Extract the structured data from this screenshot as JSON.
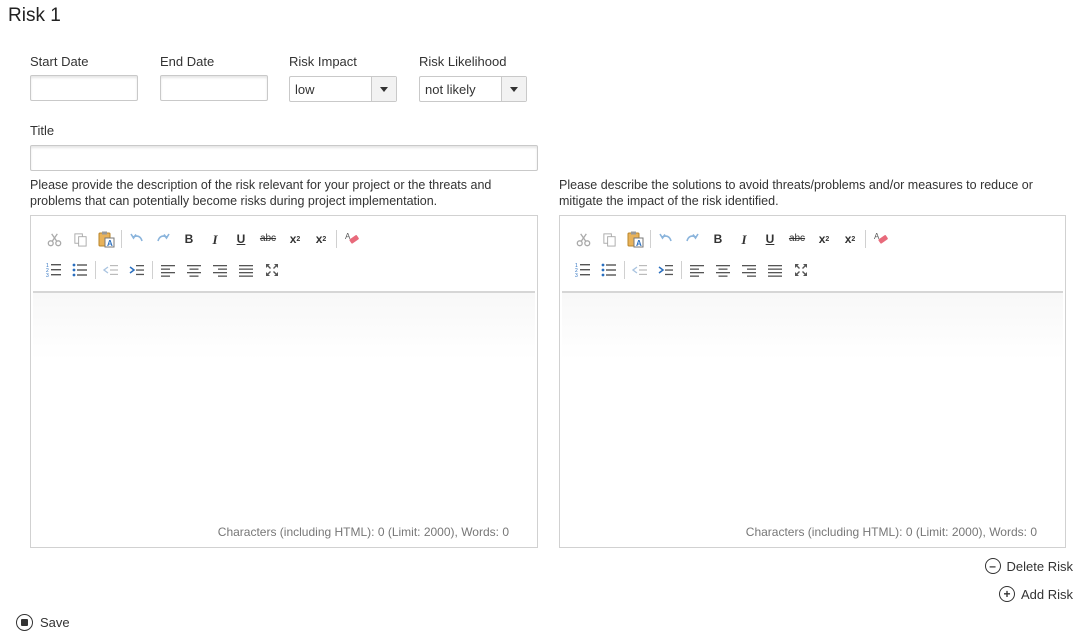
{
  "page": {
    "heading": "Risk 1"
  },
  "fields": {
    "start_date_label": "Start Date",
    "start_date_value": "",
    "end_date_label": "End Date",
    "end_date_value": "",
    "risk_impact_label": "Risk Impact",
    "risk_impact_value": "low",
    "risk_likelihood_label": "Risk Likelihood",
    "risk_likelihood_value": "not likely",
    "title_label": "Title",
    "title_value": ""
  },
  "editors": {
    "description_prompt": "Please provide the description of the risk relevant for your project or the threats and problems that can potentially become risks during project implementation.",
    "solutions_prompt": "Please describe the solutions to avoid threats/problems and/or measures to reduce or mitigate the impact of the risk identified.",
    "description_count": "Characters (including HTML): 0 (Limit: 2000), Words: 0",
    "solutions_count": "Characters (including HTML): 0 (Limit: 2000), Words: 0",
    "toolbar_icons": [
      "cut-icon",
      "copy-icon",
      "paste-icon",
      "undo-icon",
      "redo-icon",
      "bold-icon",
      "italic-icon",
      "underline-icon",
      "strikethrough-icon",
      "subscript-icon",
      "superscript-icon",
      "remove-format-icon",
      "numbered-list-icon",
      "bulleted-list-icon",
      "outdent-icon",
      "indent-icon",
      "align-left-icon",
      "align-center-icon",
      "align-right-icon",
      "justify-icon",
      "maximize-icon"
    ]
  },
  "actions": {
    "delete_risk": "Delete Risk",
    "add_risk": "Add Risk",
    "save": "Save"
  }
}
